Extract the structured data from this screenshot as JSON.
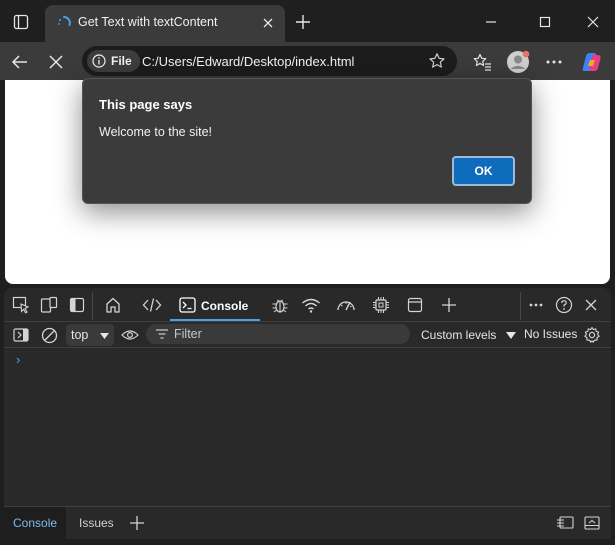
{
  "browser": {
    "tab": {
      "title": "Get Text with textContent"
    },
    "address": {
      "scheme_chip": "File",
      "url": "C:/Users/Edward/Desktop/index.html"
    }
  },
  "alert": {
    "title": "This page says",
    "message": "Welcome to the site!",
    "ok_label": "OK"
  },
  "devtools": {
    "active_tab": "Console",
    "context": "top",
    "filter_placeholder": "Filter",
    "levels_label": "Custom levels",
    "issues_label": "No Issues",
    "prompt_symbol": "›",
    "drawer_tabs": [
      "Console",
      "Issues"
    ]
  },
  "colors": {
    "accent": "#0f6cbd",
    "devtools_accent": "#4ba0e8"
  }
}
